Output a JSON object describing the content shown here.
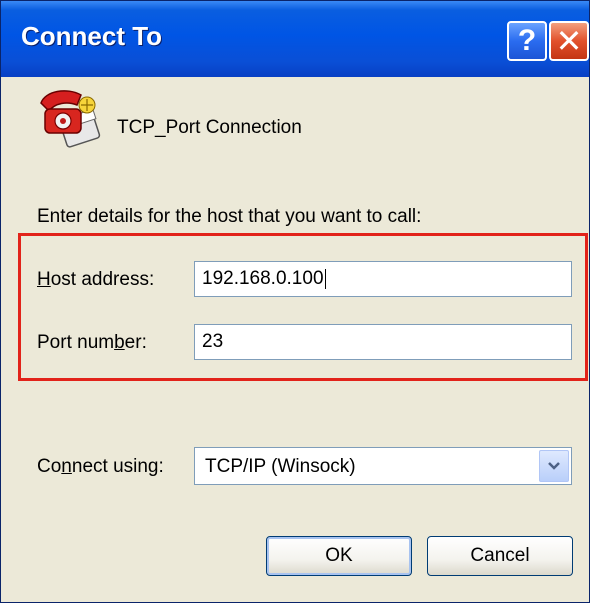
{
  "window": {
    "title": "Connect To"
  },
  "titlebar": {
    "help_glyph": "?",
    "close_glyph": "✕"
  },
  "connection": {
    "name": "TCP_Port Connection",
    "icon": "telephone-connection-icon"
  },
  "prompt": "Enter details for the host that you want to call:",
  "fields": {
    "host_label_accel": "H",
    "host_label_rest": "ost address:",
    "host_value": "192.168.0.100",
    "port_label_pre": "Port num",
    "port_label_accel": "b",
    "port_label_post": "er:",
    "port_value": "23"
  },
  "connect_using": {
    "label_pre": "Co",
    "label_accel": "n",
    "label_post": "nect using:",
    "selected": "TCP/IP (Winsock)"
  },
  "buttons": {
    "ok": "OK",
    "cancel": "Cancel"
  },
  "colors": {
    "titlebar": "#0055e5",
    "highlight": "#e2231a",
    "dialog_bg": "#ece9d8"
  }
}
